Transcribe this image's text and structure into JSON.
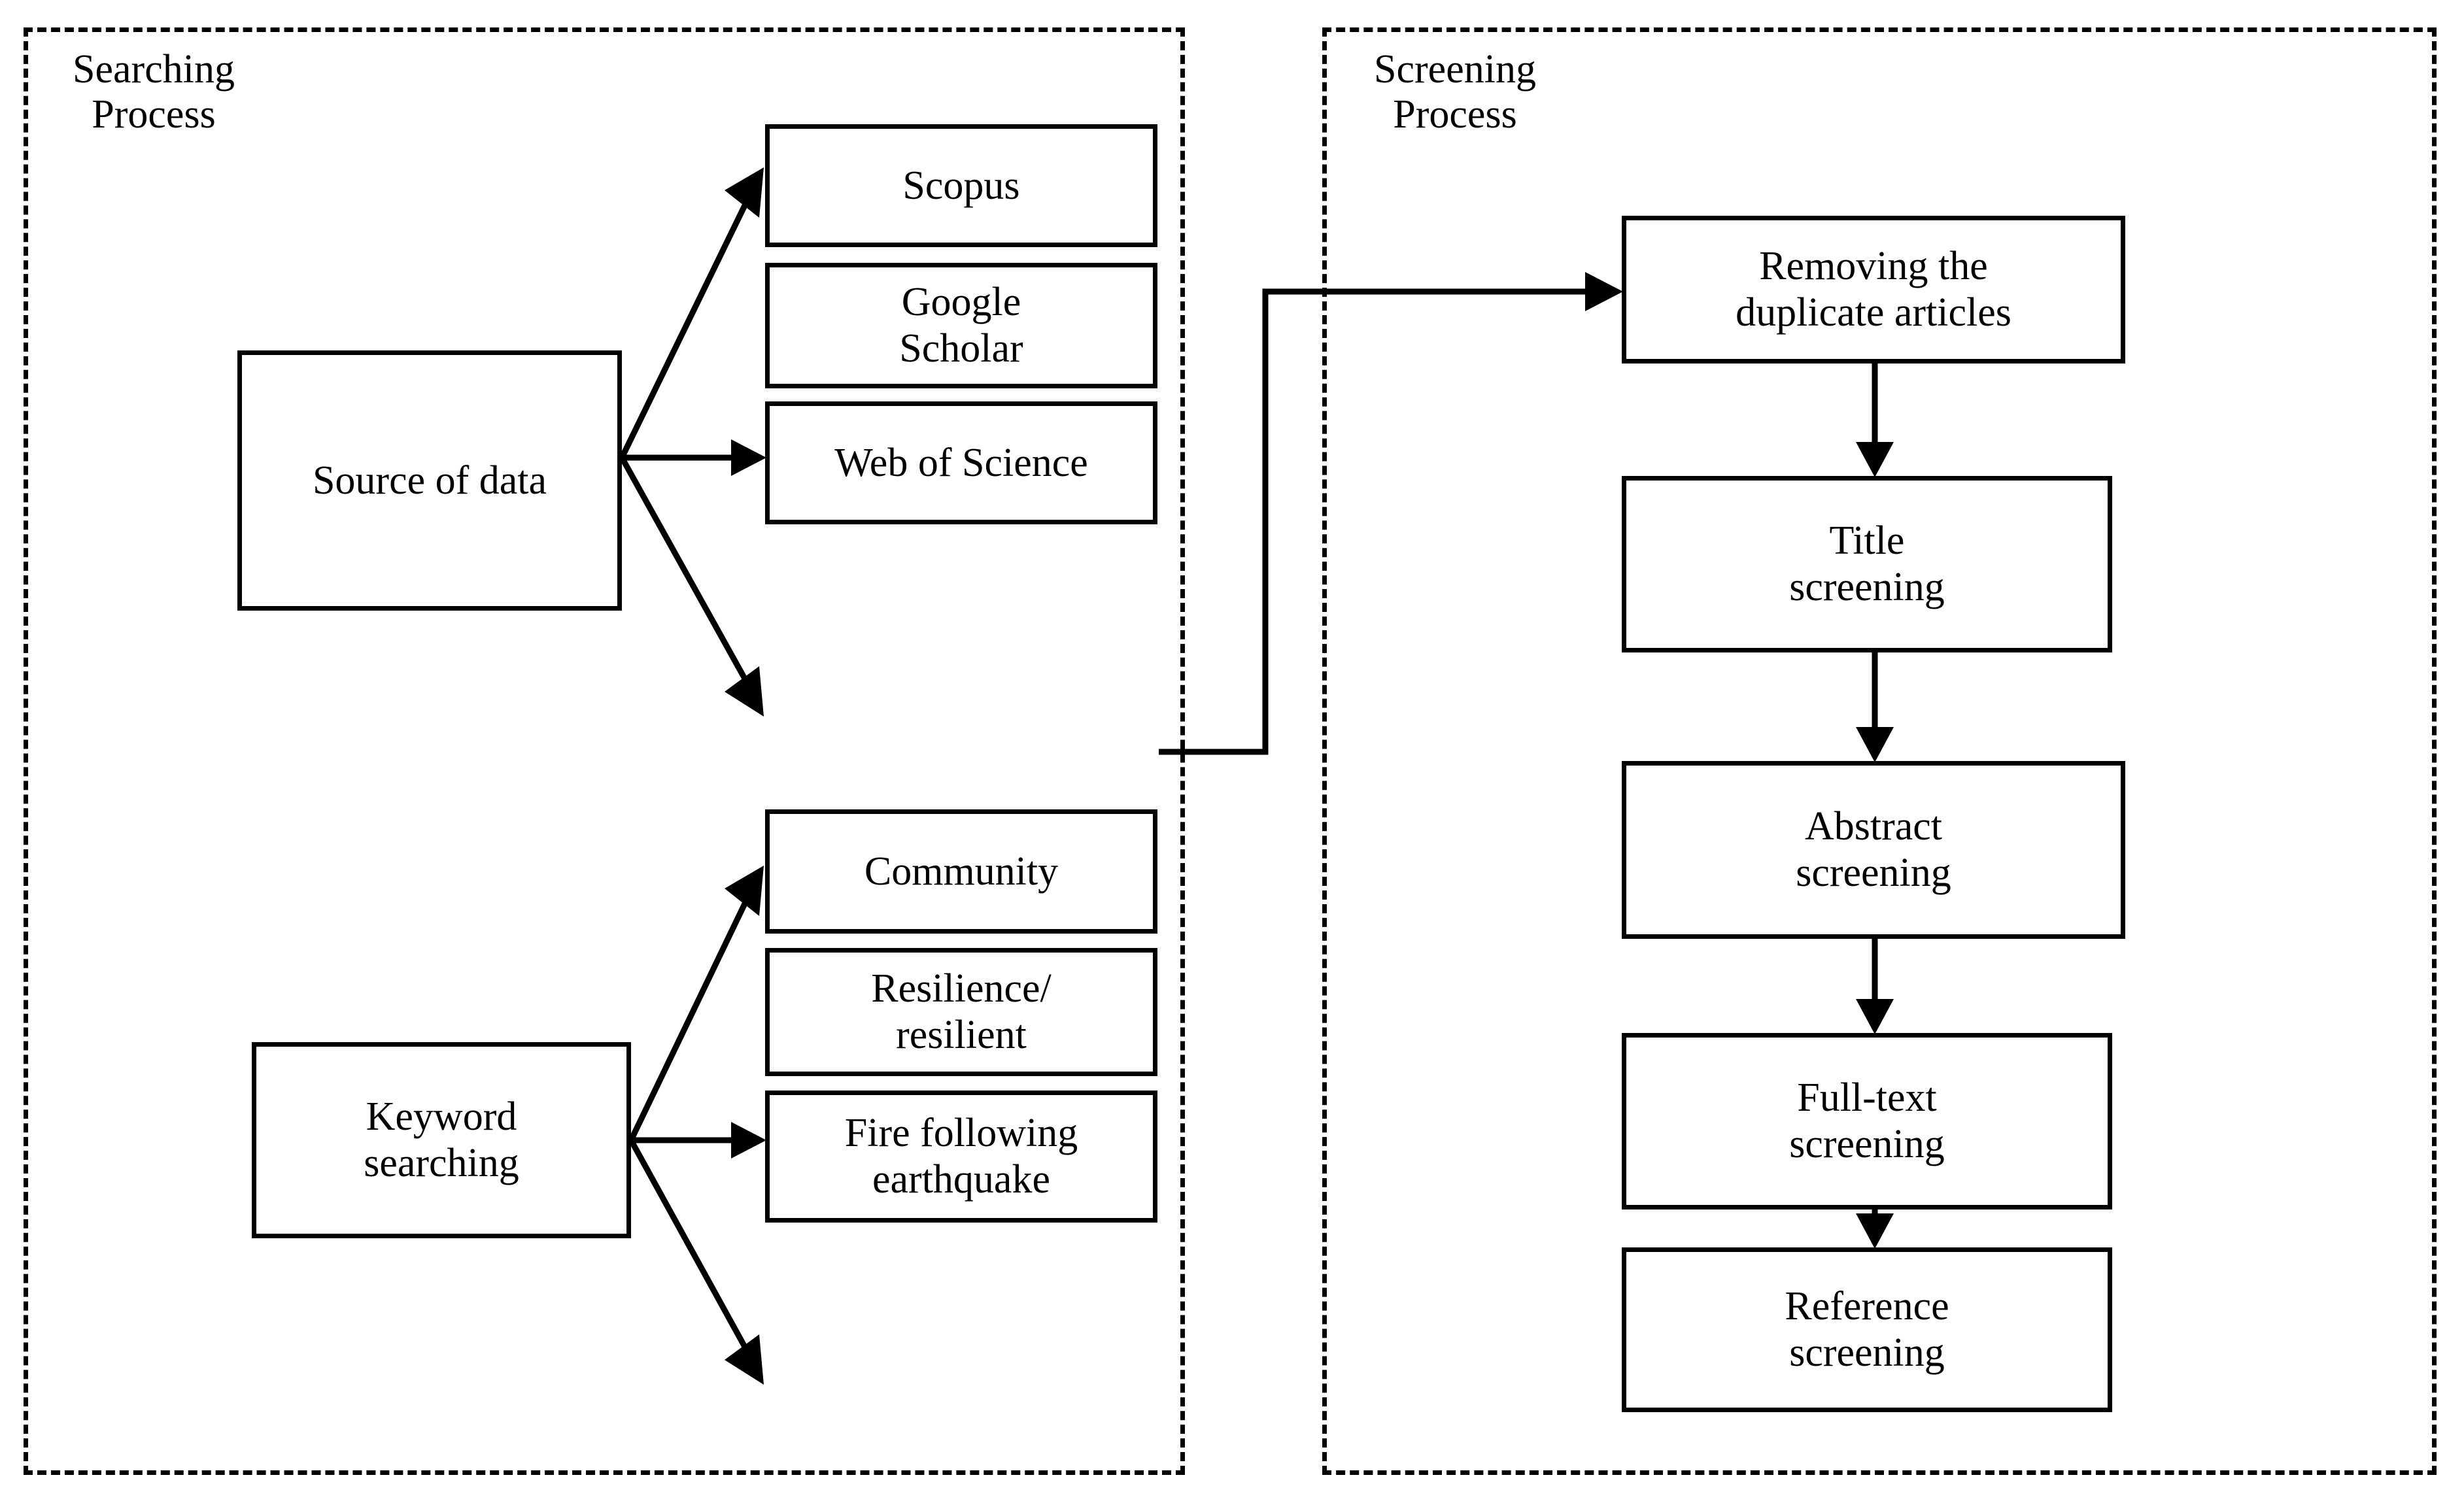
{
  "diagram": {
    "type": "flowchart",
    "panels": [
      {
        "id": "searching",
        "title": "Searching\nProcess"
      },
      {
        "id": "screening",
        "title": "Screening\nProcess"
      }
    ],
    "nodes": {
      "source_of_data": "Source of data",
      "keyword_searching": "Keyword\nsearching",
      "scopus": "Scopus",
      "google_scholar": "Google\nScholar",
      "web_of_science": "Web of Science",
      "community": "Community",
      "resilience_resilient": "Resilience/\nresilient",
      "fire_following_earthquake": "Fire following\nearthquake",
      "removing_duplicate_articles": "Removing the\nduplicate articles",
      "title_screening": "Title\nscreening",
      "abstract_screening": "Abstract\nscreening",
      "fulltext_screening": "Full-text\nscreening",
      "reference_screening": "Reference\nscreening"
    },
    "edges": [
      {
        "from": "source_of_data",
        "to": "scopus"
      },
      {
        "from": "source_of_data",
        "to": "google_scholar"
      },
      {
        "from": "source_of_data",
        "to": "web_of_science"
      },
      {
        "from": "keyword_searching",
        "to": "community"
      },
      {
        "from": "keyword_searching",
        "to": "resilience_resilient"
      },
      {
        "from": "keyword_searching",
        "to": "fire_following_earthquake"
      },
      {
        "from": "searching_panel",
        "to": "removing_duplicate_articles"
      },
      {
        "from": "removing_duplicate_articles",
        "to": "title_screening"
      },
      {
        "from": "title_screening",
        "to": "abstract_screening"
      },
      {
        "from": "abstract_screening",
        "to": "fulltext_screening"
      },
      {
        "from": "fulltext_screening",
        "to": "reference_screening"
      }
    ],
    "colors": {
      "line": "#000000",
      "box_fill": "#ffffff",
      "background": "#ffffff"
    }
  }
}
